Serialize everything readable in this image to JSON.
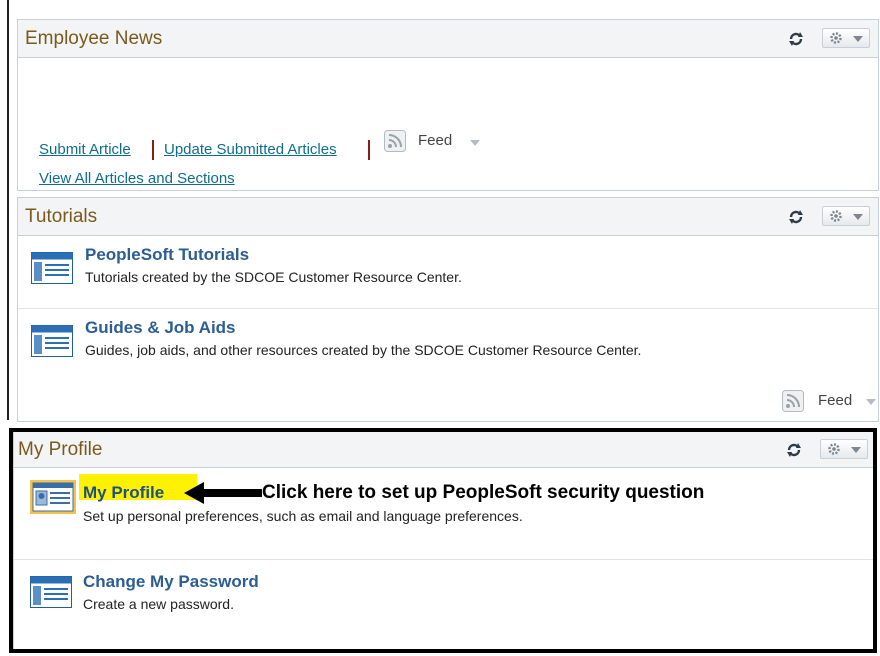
{
  "employee_news": {
    "title": "Employee News",
    "submit_article": "Submit Article",
    "update_submitted": "Update Submitted Articles",
    "feed": "Feed",
    "view_all": "View All Articles and Sections"
  },
  "tutorials": {
    "title": "Tutorials",
    "items": [
      {
        "title": "PeopleSoft Tutorials",
        "desc": "Tutorials created by the SDCOE Customer Resource Center."
      },
      {
        "title": "Guides & Job Aids",
        "desc": "Guides, job aids, and other resources created by the SDCOE Customer Resource Center."
      }
    ],
    "feed": "Feed"
  },
  "my_profile": {
    "title": "My Profile",
    "items": [
      {
        "title": "My Profile",
        "desc": "Set up personal preferences, such as email and language preferences."
      },
      {
        "title": "Change My Password",
        "desc": "Create a new password."
      }
    ]
  },
  "annotation": {
    "text": "Click here to set up PeopleSoft security question"
  },
  "colors": {
    "pagelet_title": "#7a5a1c",
    "link": "#0f6d8c",
    "item_title": "#2c5d93",
    "highlight": "#fff200"
  }
}
